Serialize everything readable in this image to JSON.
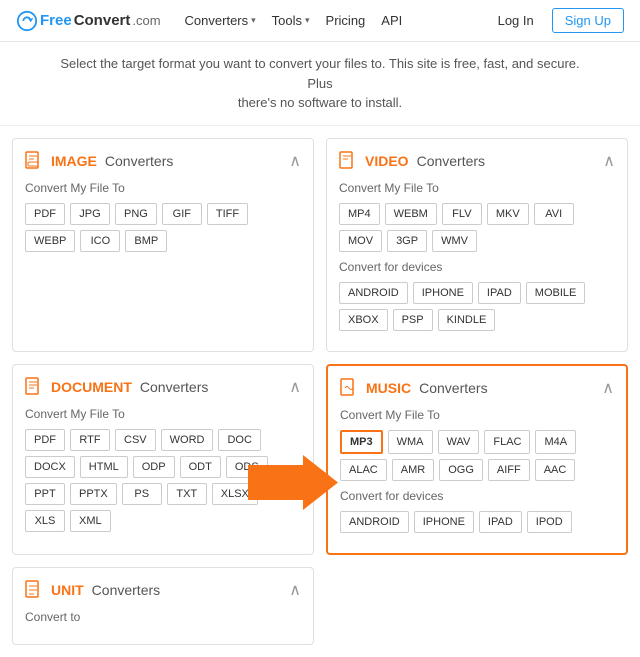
{
  "header": {
    "logo_free": "Free",
    "logo_convert": "Convert",
    "logo_com": ".com",
    "nav": [
      {
        "label": "Converters",
        "has_arrow": true
      },
      {
        "label": "Tools",
        "has_arrow": true
      },
      {
        "label": "Pricing",
        "has_arrow": false
      },
      {
        "label": "API",
        "has_arrow": false
      }
    ],
    "login_label": "Log In",
    "signup_label": "Sign Up"
  },
  "subtitle": {
    "line1": "Select the target format you want to convert your files to. This site is free, fast, and secure. Plus",
    "line2": "there's no software to install."
  },
  "cards": [
    {
      "id": "image",
      "type": "IMAGE",
      "label": "Converters",
      "highlighted": false,
      "sections": [
        {
          "title": "Convert My File To",
          "formats": [
            "PDF",
            "JPG",
            "PNG",
            "GIF",
            "TIFF",
            "WEBP",
            "ICO",
            "BMP"
          ]
        }
      ]
    },
    {
      "id": "video",
      "type": "VIDEO",
      "label": "Converters",
      "highlighted": false,
      "sections": [
        {
          "title": "Convert My File To",
          "formats": [
            "MP4",
            "WEBM",
            "FLV",
            "MKV",
            "AVI",
            "MOV",
            "3GP",
            "WMV"
          ]
        },
        {
          "title": "Convert for devices",
          "formats": [
            "ANDROID",
            "IPHONE",
            "IPAD",
            "MOBILE",
            "XBOX",
            "PSP",
            "KINDLE"
          ]
        }
      ]
    },
    {
      "id": "document",
      "type": "DOCUMENT",
      "label": "Converters",
      "highlighted": false,
      "sections": [
        {
          "title": "Convert My File To",
          "formats": [
            "PDF",
            "RTF",
            "CSV",
            "WORD",
            "DOC",
            "DOCX",
            "HTML",
            "ODP",
            "ODT",
            "ODS",
            "PPT",
            "PPTX",
            "PS",
            "TXT",
            "XLSX",
            "XLS",
            "XML"
          ]
        }
      ]
    },
    {
      "id": "music",
      "type": "MUSIC",
      "label": "Converters",
      "highlighted": true,
      "sections": [
        {
          "title": "Convert My File To",
          "formats": [
            "MP3",
            "WMA",
            "WAV",
            "FLAC",
            "M4A",
            "ALAC",
            "AMR",
            "OGG",
            "AIFF",
            "AAC"
          ]
        },
        {
          "title": "Convert for devices",
          "formats": [
            "ANDROID",
            "IPHONE",
            "IPAD",
            "IPOD"
          ]
        }
      ]
    }
  ],
  "bottom_cards": [
    {
      "id": "unit",
      "type": "UNIT",
      "label": "Converters",
      "highlighted": false,
      "sections": [
        {
          "title": "Convert to",
          "formats": []
        }
      ]
    }
  ],
  "highlighted_format": "MP3"
}
